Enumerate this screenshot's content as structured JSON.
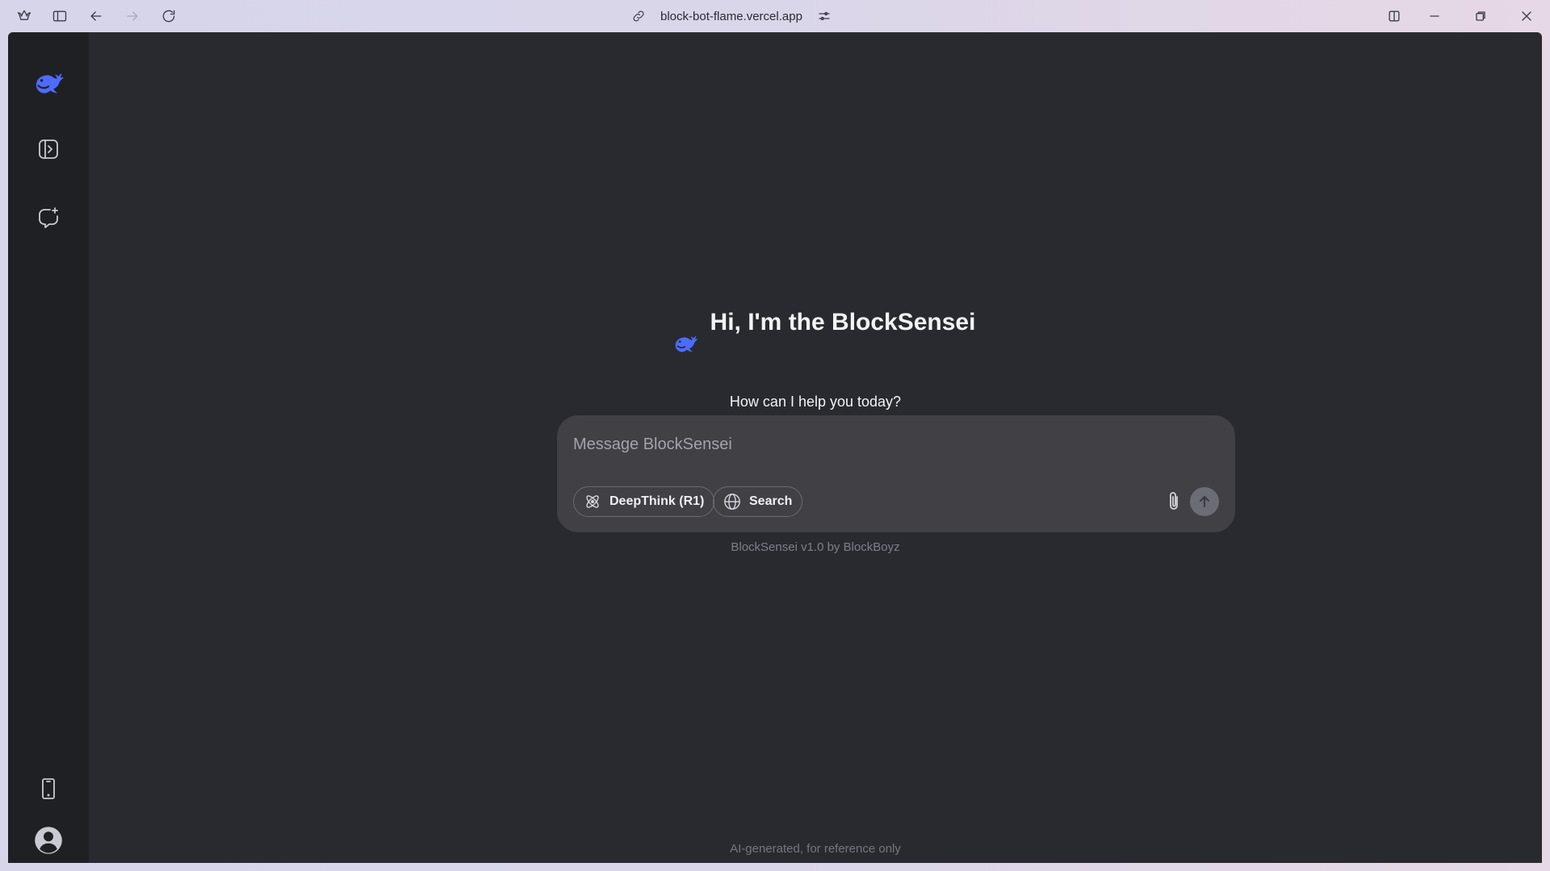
{
  "browser": {
    "url": "block-bot-flame.vercel.app",
    "icons": {
      "logo": "browser-logo-icon",
      "sidebar": "sidebar-toggle-icon",
      "back": "back-arrow-icon",
      "forward": "forward-arrow-icon",
      "reload": "reload-icon",
      "link": "link-icon",
      "site_settings": "sliders-icon",
      "split": "split-view-icon",
      "minimize": "minimize-icon",
      "restore": "restore-icon",
      "close": "close-icon"
    }
  },
  "sidebar": {
    "items": [
      {
        "name": "logo",
        "icon": "whale-logo-icon"
      },
      {
        "name": "open-sidebar",
        "icon": "panel-open-icon"
      },
      {
        "name": "new-chat",
        "icon": "new-chat-icon"
      },
      {
        "name": "get-app",
        "icon": "phone-icon"
      },
      {
        "name": "profile",
        "icon": "user-avatar-icon"
      }
    ]
  },
  "hero": {
    "title": "Hi, I'm the BlockSensei",
    "subtitle": "How can I help you today?"
  },
  "composer": {
    "placeholder": "Message BlockSensei",
    "value": "",
    "deepthink_label": "DeepThink (R1)",
    "search_label": "Search"
  },
  "version_text": "BlockSensei v1.0 by BlockBoyz",
  "footer_note": "AI-generated, for reference only",
  "colors": {
    "brand": "#4d6bfe",
    "app_bg": "#292a2f",
    "rail_bg": "#1f2023",
    "composer_bg": "#404045"
  }
}
